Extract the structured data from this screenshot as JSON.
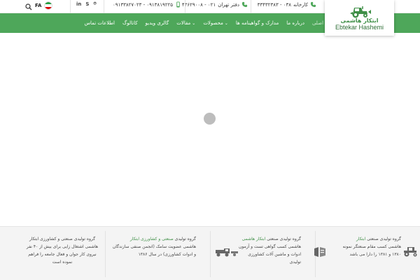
{
  "topbar": {
    "factory_label": "کارخانه",
    "factory_phone": "۰۳۸ - ۳۳۴۳۲۳۸۳",
    "office_label": "دفتر تهران",
    "office_phone": "۰۲۱ - ۴۴۶۲۹۰۰۸",
    "mobile_phones": "۰۹۱۳۸۱۹۲۲۵ - ۰۹۱۳۳۸۲۷۰۲۳",
    "social": [
      "in",
      "S",
      "⌾"
    ],
    "lang": "FA"
  },
  "logo": {
    "name_fa": "ابتکار هاشمی",
    "name_en": "Ebtekar Hashemi"
  },
  "nav": {
    "items": [
      {
        "label": "صفحه اصلی",
        "active": true,
        "dropdown": false
      },
      {
        "label": "درباره ما",
        "active": false,
        "dropdown": false
      },
      {
        "label": "مدارک و گواهینامه ها",
        "active": false,
        "dropdown": false
      },
      {
        "label": "محصولات",
        "active": false,
        "dropdown": true
      },
      {
        "label": "مقالات",
        "active": false,
        "dropdown": true
      },
      {
        "label": "گالری ویدیو",
        "active": false,
        "dropdown": false
      },
      {
        "label": "کاتالوگ",
        "active": false,
        "dropdown": false
      },
      {
        "label": "اطلاعات تماس",
        "active": false,
        "dropdown": false
      }
    ]
  },
  "footer": {
    "col1": {
      "title": "گروه تولیدی صنعتی",
      "highlight": "ابتکار",
      "text2": "هاشمی کسب مقام صنعتگر نمونه",
      "text3": "۱۳۸۰ و ۱۳۸۱ را دارا می باشد"
    },
    "col2": {
      "title": "گروه تولیدی صنعتی",
      "highlight": "ابتکار هاشمی",
      "text2": "هاشمی کسب گواهی تست و آزمون",
      "text3": "ادوات و ماشین آلات کشاورزی",
      "text4": "تولیدی"
    },
    "col3": {
      "title": "گروه تولیدی",
      "highlight": "صنعتی و کشاورزی ابتکار",
      "text2": "هاشمی عضویت سامک (انجمن صنفی سازندگان",
      "text3": "و ادوات کشاورزی) در سال ۱۳۸۶"
    },
    "col4": {
      "line1": "گروه تولیدی صنعتی و کشاورزی ابتکار",
      "line2": "هاشمی اشتغال زایی برای بیش از ۴۰ نفر",
      "line3": "نیروی کار جوان و فعال جامعه را فراهم",
      "line4": "نموده است"
    }
  },
  "colors": {
    "brand_green": "#4ea75a",
    "logo_green": "#3f8f47"
  }
}
